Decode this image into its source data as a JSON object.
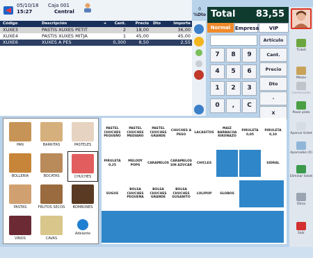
{
  "header": {
    "date": "05/10/18",
    "time": "15:27",
    "caja": "Caja 001",
    "location": "Central"
  },
  "dto": {
    "value": "0",
    "label": "%Dto"
  },
  "table": {
    "add_symbol": "+",
    "columns": [
      "Código",
      "Descripción",
      "Cant.",
      "Precio",
      "Dto",
      "Importe"
    ],
    "rows": [
      {
        "codigo": "XUXE3",
        "desc": "PASTIS XUXES PETIT",
        "cant": "2",
        "precio": "18,00",
        "dto": "",
        "importe": "36,00"
      },
      {
        "codigo": "XUXE4",
        "desc": "PASTIS XUXES MITJA",
        "cant": "1",
        "precio": "45,00",
        "dto": "",
        "importe": "45,00"
      },
      {
        "codigo": "XUXE6",
        "desc": "XUXES A PES",
        "cant": "0,300",
        "precio": "8,50",
        "dto": "",
        "importe": "2,55"
      }
    ]
  },
  "total": {
    "label": "Total",
    "value": "83,55"
  },
  "modes": [
    "Normal",
    "Empresa",
    "VIP"
  ],
  "keypad": {
    "articulo": "Artículo",
    "keys": [
      "7",
      "8",
      "9",
      "4",
      "5",
      "6",
      "1",
      "2",
      "3",
      "0",
      ",",
      "C"
    ],
    "side": [
      "Cant.",
      "Precio",
      "Dto",
      "-",
      "X"
    ]
  },
  "tools": [
    "Ticket",
    "Mesas",
    "Comensales",
    "Pasar plato",
    "Aparcar ticket",
    "Aparcados (X)",
    "Eliminar ticket",
    "Otros",
    "Salir"
  ],
  "categories": [
    "PAN",
    "BARRITAS",
    "PASTELES",
    "BOLLERIA",
    "BOCATAS",
    "CHUCHES",
    "PASTAS",
    "FRUTOS SECOS",
    "BOMBONES",
    "VINOS",
    "CAVAS",
    "Adelante"
  ],
  "products": [
    "PASTEL CHUCHES PEQUEÑO",
    "PASTEL CHUCHES MEDIANO",
    "PASTEL CHUCHES GRANDE",
    "CHUCHES A PESO",
    "LACASITOS",
    "MAIZ BARBACOA KIKONAZO",
    "PIRULETA 0,05",
    "PIRULETA 0,10",
    "PIRULETA 0,25",
    "MELODY POPS",
    "CARAMELOS",
    "CARAMELOS SIN AZÚCAR",
    "CHICLES",
    "",
    "",
    "SIDRAL",
    "SUGUS",
    "BOLSA CHUCHES PEQUEÑA",
    "BOLSA CHUCHES GRANDE",
    "BOLSA CHUCHES GUSANITO",
    "LOLIPOP",
    "GLOBOS"
  ],
  "colors": {
    "header_bg": "#18305a",
    "total_bg": "#0f3b2e",
    "normal_btn": "#f08a2a",
    "product_blue": "#2f86c9",
    "exit_red": "#d32f2f"
  }
}
